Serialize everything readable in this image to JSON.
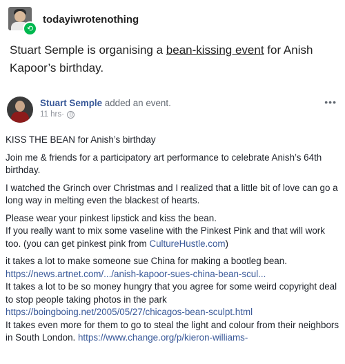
{
  "post": {
    "username": "todayiwrotenothing",
    "text_before": "Stuart Semple is organising a ",
    "link_text": "bean-kissing event",
    "text_after": " for Anish Kapoor’s birthday."
  },
  "fb": {
    "poster_name": "Stuart Semple",
    "action": " added an event.",
    "time": "11 hrs",
    "dot": " · ",
    "more": "•••",
    "title": "KISS THE BEAN for Anish’s birthday",
    "p1": "Join me & friends for a participatory art performance to celebrate Anish’s 64th birthday.",
    "p2": "I watched the Grinch over Christmas and I realized that a little bit of love can go a long way in melting even the blackest of hearts.",
    "p3a": "Please wear your pinkest lipstick and kiss the bean.",
    "p3b_before": "If you really want to mix some vaseline with the Pinkest Pink and that will work too. (you can get pinkest pink from ",
    "p3b_link": "CultureHustle.com",
    "p3b_after": ")",
    "p4a": "it takes a lot to make someone sue China for making a bootleg bean.",
    "p4_link1": "https://news.artnet.com/.../anish-kapoor-sues-china-bean-scul...",
    "p4b": "It takes a lot to be so money hungry that you agree for some weird copyright deal to stop people taking photos in the park",
    "p4_link2": "https://boingboing.net/2005/05/27/chicagos-bean-sculpt.html",
    "p4c": "It takes even more for them to go to steal the light and colour from their neighbors in South London. ",
    "p4_link3": "https://www.change.org/p/kieron-williams-"
  },
  "colors": {
    "fb_link": "#385898",
    "reblog_green": "#00b84f"
  },
  "icons": {
    "reblog": "reblog-icon",
    "globe": "globe-icon",
    "more": "more-options-icon"
  }
}
